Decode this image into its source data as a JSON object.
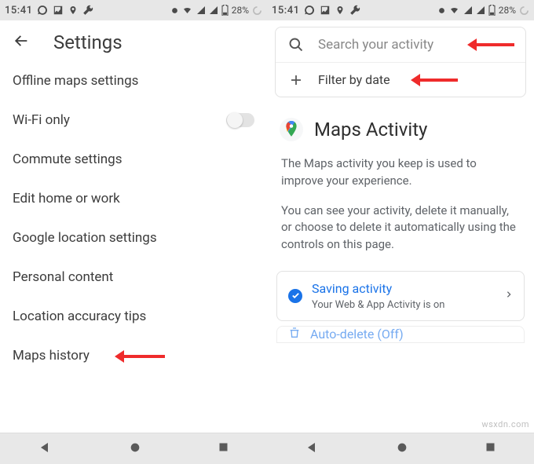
{
  "status": {
    "time": "15:41",
    "battery": "28%"
  },
  "left": {
    "title": "Settings",
    "items": [
      "Offline maps settings",
      "Wi-Fi only",
      "Commute settings",
      "Edit home or work",
      "Google location settings",
      "Personal content",
      "Location accuracy tips",
      "Maps history"
    ]
  },
  "right": {
    "search_placeholder": "Search your activity",
    "filter_label": "Filter by date",
    "section_title": "Maps Activity",
    "para1": "The Maps activity you keep is used to improve your experience.",
    "para2": "You can see your activity, delete it manually, or choose to delete it automatically using the controls on this page.",
    "saving_title": "Saving activity",
    "saving_sub": "Your Web & App Activity is on",
    "autodelete": "Auto-delete (Off)"
  },
  "watermark": "wsxdn.com"
}
